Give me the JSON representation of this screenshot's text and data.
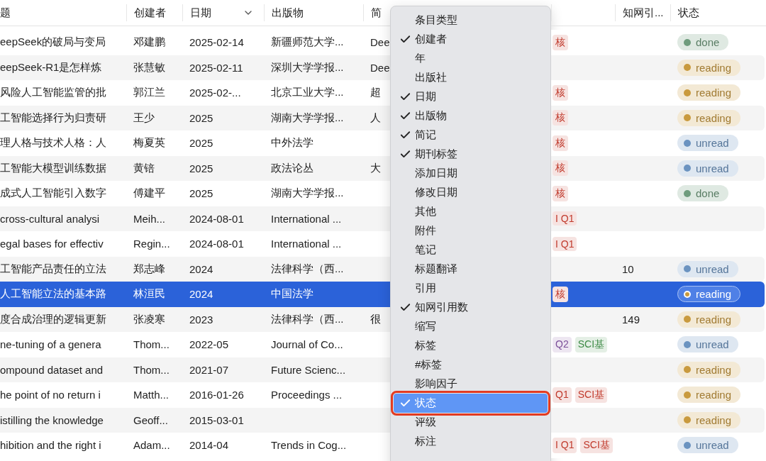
{
  "table": {
    "columns": [
      {
        "label": "题"
      },
      {
        "label": "创建者"
      },
      {
        "label": "日期",
        "sorted": true
      },
      {
        "label": "出版物"
      },
      {
        "label": "简"
      },
      {
        "label": "知网引..."
      },
      {
        "label": "状态"
      }
    ],
    "rows": [
      {
        "title": "eepSeek的破局与变局",
        "creator": "邓建鹏",
        "date": "2025-02-14",
        "publication": "新疆师范大学...",
        "note": "Dee",
        "tags": [
          {
            "text": "核",
            "color": "#c0392b"
          }
        ],
        "citations": "",
        "status": {
          "label": "done",
          "color": "#6f9c7d"
        },
        "selected": false
      },
      {
        "title": "eepSeek-R1是怎样炼",
        "creator": "张慧敏",
        "date": "2025-02-11",
        "publication": "深圳大学学报...",
        "note": "Dee",
        "tags": [],
        "citations": "",
        "status": {
          "label": "reading",
          "color": "#c99a3e"
        },
        "selected": false
      },
      {
        "title": "风险人工智能监管的批",
        "creator": "郭江兰",
        "date": "2025-02-...",
        "publication": "北京工业大学...",
        "note": "超",
        "tags": [
          {
            "text": "核",
            "color": "#c0392b"
          }
        ],
        "citations": "",
        "status": {
          "label": "reading",
          "color": "#c99a3e"
        },
        "selected": false
      },
      {
        "title": "工智能选择行为归责研",
        "creator": "王少",
        "date": "2025",
        "publication": "湖南大学学报...",
        "note": "人",
        "tags": [
          {
            "text": "核",
            "color": "#c0392b"
          }
        ],
        "citations": "",
        "status": {
          "label": "reading",
          "color": "#c99a3e"
        },
        "selected": false
      },
      {
        "title": "理人格与技术人格：人",
        "creator": "梅夏英",
        "date": "2025",
        "publication": "中外法学",
        "note": "",
        "tags": [
          {
            "text": "核",
            "color": "#c0392b"
          }
        ],
        "citations": "",
        "status": {
          "label": "unread",
          "color": "#6b93c0"
        },
        "selected": false
      },
      {
        "title": "工智能大模型训练数据",
        "creator": "黄锫",
        "date": "2025",
        "publication": "政法论丛",
        "note": "大",
        "tags": [
          {
            "text": "核",
            "color": "#c0392b"
          }
        ],
        "citations": "",
        "status": {
          "label": "unread",
          "color": "#6b93c0"
        },
        "selected": false
      },
      {
        "title": "成式人工智能引入数字",
        "creator": "傅建平",
        "date": "2025",
        "publication": "湖南大学学报...",
        "note": "",
        "tags": [
          {
            "text": "核",
            "color": "#c0392b"
          }
        ],
        "citations": "",
        "status": {
          "label": "done",
          "color": "#6f9c7d"
        },
        "selected": false
      },
      {
        "title": "cross-cultural analysi",
        "creator": "Meih...",
        "date": "2024-08-01",
        "publication": "International ...",
        "note": "",
        "tags": [
          {
            "text": "I Q1",
            "color": "#c0392b"
          }
        ],
        "citations": "",
        "status": null,
        "selected": false
      },
      {
        "title": "egal bases for effectiv",
        "creator": "Regin...",
        "date": "2024-08-01",
        "publication": "International ...",
        "note": "",
        "tags": [
          {
            "text": "I Q1",
            "color": "#c0392b"
          }
        ],
        "citations": "",
        "status": null,
        "selected": false
      },
      {
        "title": "工智能产品责任的立法",
        "creator": "郑志峰",
        "date": "2024",
        "publication": "法律科学（西...",
        "note": "",
        "tags": [],
        "citations": "10",
        "status": {
          "label": "unread",
          "color": "#6b93c0"
        },
        "selected": false
      },
      {
        "title": "人工智能立法的基本路",
        "creator": "林洹民",
        "date": "2024",
        "publication": "中国法学",
        "note": "",
        "tags": [
          {
            "text": "核",
            "color": "#c0392b"
          }
        ],
        "citations": "",
        "status": {
          "label": "reading",
          "color": "#c99a3e"
        },
        "selected": true
      },
      {
        "title": "度合成治理的逻辑更新",
        "creator": "张凌寒",
        "date": "2023",
        "publication": "法律科学（西...",
        "note": "很",
        "tags": [],
        "citations": "149",
        "status": {
          "label": "reading",
          "color": "#c99a3e"
        },
        "selected": false
      },
      {
        "title": "ne-tuning of a genera",
        "creator": "Thom...",
        "date": "2022-05",
        "publication": "Journal of Co...",
        "note": "",
        "tags": [
          {
            "text": "Q2",
            "color": "#7b4f99"
          },
          {
            "text": "SCI基",
            "color": "#3d8a46"
          }
        ],
        "citations": "",
        "status": {
          "label": "unread",
          "color": "#6b93c0"
        },
        "selected": false
      },
      {
        "title": "ompound dataset and",
        "creator": "Thom...",
        "date": "2021-07",
        "publication": "Future Scienc...",
        "note": "",
        "tags": [],
        "citations": "",
        "status": {
          "label": "reading",
          "color": "#c99a3e"
        },
        "selected": false
      },
      {
        "title": "he point of no return i",
        "creator": "Matth...",
        "date": "2016-01-26",
        "publication": "Proceedings ...",
        "note": "",
        "tags": [
          {
            "text": "Q1",
            "color": "#c0392b"
          },
          {
            "text": "SCI基",
            "color": "#c0392b"
          }
        ],
        "citations": "",
        "status": {
          "label": "reading",
          "color": "#c99a3e"
        },
        "selected": false
      },
      {
        "title": "istilling the knowledge",
        "creator": "Geoff...",
        "date": "2015-03-01",
        "publication": "",
        "note": "",
        "tags": [],
        "citations": "",
        "status": {
          "label": "reading",
          "color": "#c99a3e"
        },
        "selected": false
      },
      {
        "title": "hibition and the right i",
        "creator": "Adam...",
        "date": "2014-04",
        "publication": "Trends in Cog...",
        "note": "",
        "tags": [
          {
            "text": "I Q1",
            "color": "#c0392b"
          },
          {
            "text": "SCI基",
            "color": "#c0392b"
          }
        ],
        "citations": "",
        "status": {
          "label": "unread",
          "color": "#6b93c0"
        },
        "selected": false
      }
    ]
  },
  "column_menu": {
    "items": [
      {
        "label": "条目类型",
        "checked": false,
        "selected": false
      },
      {
        "label": "创建者",
        "checked": true,
        "selected": false
      },
      {
        "label": "年",
        "checked": false,
        "selected": false
      },
      {
        "label": "出版社",
        "checked": false,
        "selected": false
      },
      {
        "label": "日期",
        "checked": true,
        "selected": false
      },
      {
        "label": "出版物",
        "checked": true,
        "selected": false
      },
      {
        "label": "简记",
        "checked": true,
        "selected": false
      },
      {
        "label": "期刊标签",
        "checked": true,
        "selected": false
      },
      {
        "label": "添加日期",
        "checked": false,
        "selected": false
      },
      {
        "label": "修改日期",
        "checked": false,
        "selected": false
      },
      {
        "label": "其他",
        "checked": false,
        "selected": false
      },
      {
        "label": "附件",
        "checked": false,
        "selected": false
      },
      {
        "label": "笔记",
        "checked": false,
        "selected": false
      },
      {
        "label": "标题翻译",
        "checked": false,
        "selected": false
      },
      {
        "label": "引用",
        "checked": false,
        "selected": false
      },
      {
        "label": "知网引用数",
        "checked": true,
        "selected": false
      },
      {
        "label": "缩写",
        "checked": false,
        "selected": false
      },
      {
        "label": "标签",
        "checked": false,
        "selected": false
      },
      {
        "label": "#标签",
        "checked": false,
        "selected": false
      },
      {
        "label": "影响因子",
        "checked": false,
        "selected": false
      },
      {
        "label": "状态",
        "checked": true,
        "selected": true
      },
      {
        "label": "评级",
        "checked": false,
        "selected": false
      },
      {
        "label": "标注",
        "checked": false,
        "selected": false
      }
    ]
  }
}
